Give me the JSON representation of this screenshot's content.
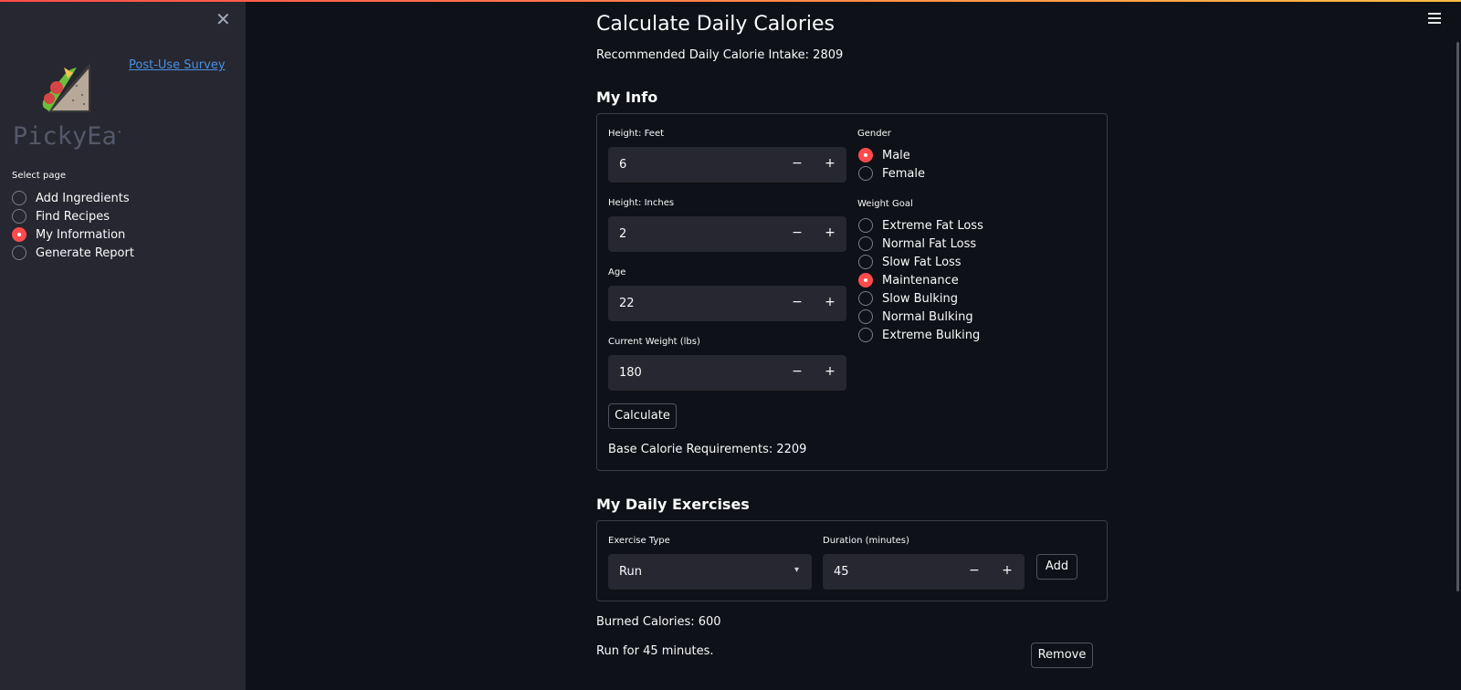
{
  "sidebar": {
    "close_icon": "close-icon",
    "logo_text": "PickyEats",
    "survey_link": "Post-Use Survey",
    "select_label": "Select page",
    "pages": [
      {
        "label": "Add Ingredients",
        "selected": false
      },
      {
        "label": "Find Recipes",
        "selected": false
      },
      {
        "label": "My Information",
        "selected": true
      },
      {
        "label": "Generate Report",
        "selected": false
      }
    ]
  },
  "main": {
    "title": "Calculate Daily Calories",
    "recommended": "Recommended Daily Calorie Intake: 2809",
    "my_info": {
      "heading": "My Info",
      "height_feet": {
        "label": "Height: Feet",
        "value": "6"
      },
      "height_inches": {
        "label": "Height: Inches",
        "value": "2"
      },
      "age": {
        "label": "Age",
        "value": "22"
      },
      "weight": {
        "label": "Current Weight (lbs)",
        "value": "180"
      },
      "minus": "−",
      "plus": "+",
      "gender": {
        "label": "Gender",
        "options": [
          {
            "label": "Male",
            "selected": true
          },
          {
            "label": "Female",
            "selected": false
          }
        ]
      },
      "weight_goal": {
        "label": "Weight Goal",
        "options": [
          {
            "label": "Extreme Fat Loss",
            "selected": false
          },
          {
            "label": "Normal Fat Loss",
            "selected": false
          },
          {
            "label": "Slow Fat Loss",
            "selected": false
          },
          {
            "label": "Maintenance",
            "selected": true
          },
          {
            "label": "Slow Bulking",
            "selected": false
          },
          {
            "label": "Normal Bulking",
            "selected": false
          },
          {
            "label": "Extreme Bulking",
            "selected": false
          }
        ]
      },
      "calculate_button": "Calculate",
      "base_calories": "Base Calorie Requirements: 2209"
    },
    "exercises": {
      "heading": "My Daily Exercises",
      "type_label": "Exercise Type",
      "type_value": "Run",
      "duration_label": "Duration (minutes)",
      "duration_value": "45",
      "add_button": "Add",
      "burned": "Burned Calories: 600",
      "entry": "Run for 45 minutes.",
      "remove_button": "Remove"
    }
  },
  "colors": {
    "accent": "#ff4b4b",
    "background": "#0e1117",
    "sidebar": "#262730",
    "link": "#4a90e2"
  }
}
